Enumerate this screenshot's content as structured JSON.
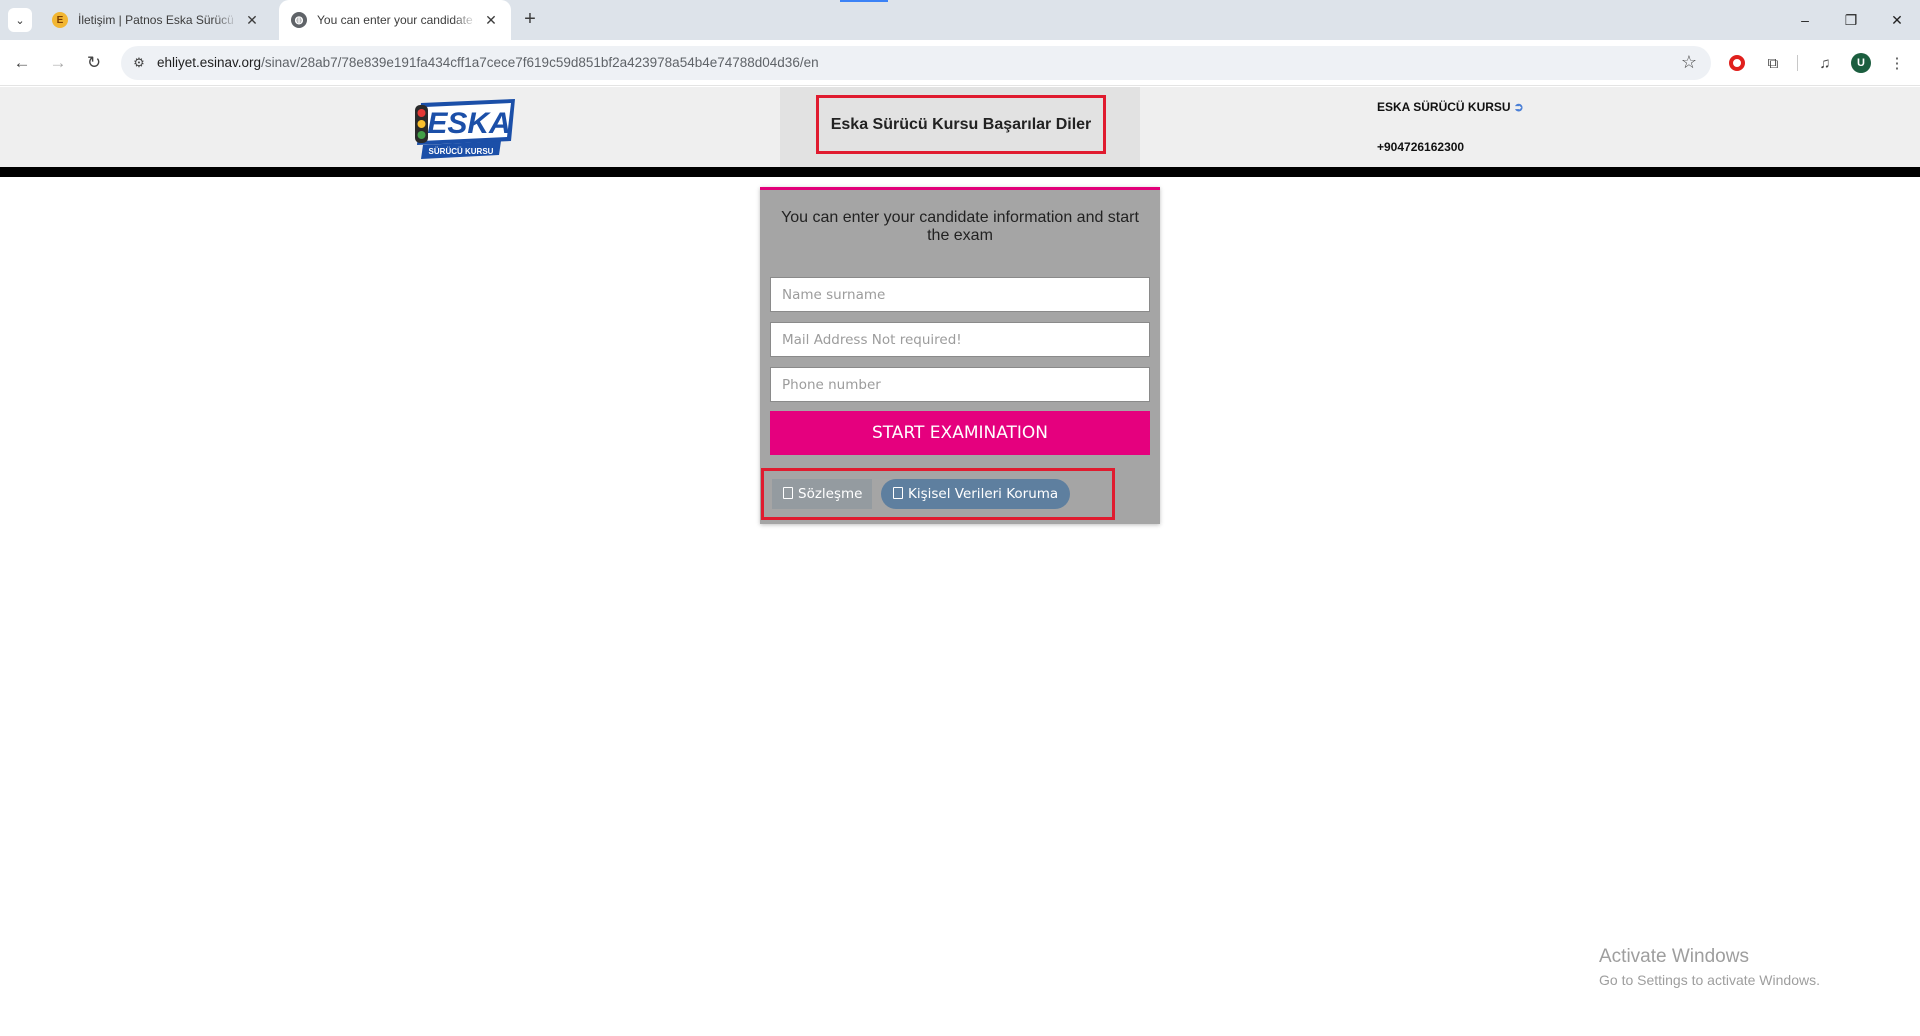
{
  "browser": {
    "tabs": [
      {
        "title": "İletişim | Patnos Eska Sürücü Kursu",
        "active": false,
        "favicon": "eska-favicon"
      },
      {
        "title": "You can enter your candidate information and start the exam",
        "active": true,
        "favicon": "globe-icon"
      }
    ],
    "new_tab": "+",
    "url_host": "ehliyet.esinav.org",
    "url_path": "/sinav/28ab7/78e839e191fa434cff1a7cece7f619c59d851bf2a423978a54b4e74788d04d36/en",
    "profile_initial": "U",
    "window_controls": {
      "minimize": "–",
      "restore": "❐",
      "close": "✕"
    }
  },
  "header": {
    "logo_text": "ESKA",
    "logo_subtext": "SÜRÜCÜ KURSU",
    "slogan": "Eska Sürücü Kursu Başarılar Diler",
    "brand_link": "ESKA SÜRÜCÜ KURSU",
    "phone": "+904726162300"
  },
  "form": {
    "heading": "You can enter your candidate information and start the exam",
    "name_placeholder": "Name surname",
    "mail_placeholder": "Mail Address Not required!",
    "phone_placeholder": "Phone number",
    "start_button": "START EXAMINATION",
    "agreement_link": "Sözleşme",
    "privacy_link": "Kişisel Verileri Koruma"
  },
  "watermark": {
    "title": "Activate Windows",
    "subtitle": "Go to Settings to activate Windows."
  },
  "colors": {
    "accent": "#e5007e",
    "highlight_border": "#e01b2f",
    "card_bg": "#a5a5a5",
    "privacy_pill": "#5e7f9f"
  }
}
